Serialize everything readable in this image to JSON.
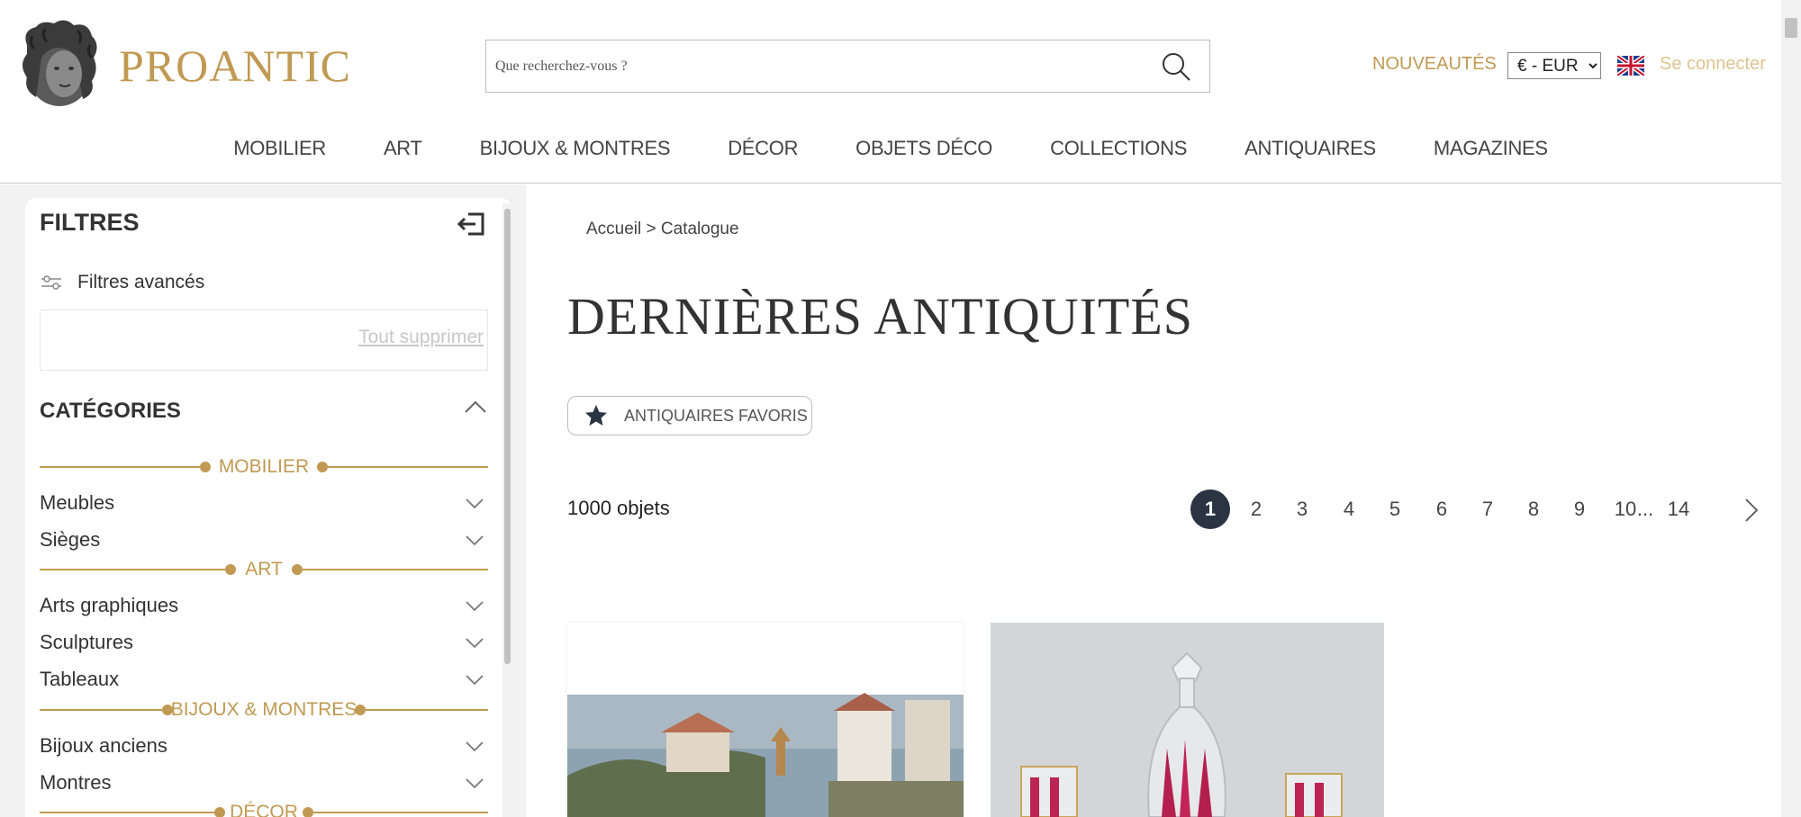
{
  "header": {
    "logo_text": "PROANTIC",
    "search_placeholder": "Que recherchez-vous ?",
    "new_label": "NOUVEAUTÉS",
    "currency": "€ - EUR",
    "login_label": "Se connecter",
    "flag_icon": "uk-flag-icon",
    "search_icon": "search-icon"
  },
  "nav": [
    "MOBILIER",
    "ART",
    "BIJOUX & MONTRES",
    "DÉCOR",
    "OBJETS DÉCO",
    "COLLECTIONS",
    "ANTIQUAIRES",
    "MAGAZINES"
  ],
  "sidebar": {
    "title": "FILTRES",
    "advanced_filters": "Filtres avancés",
    "clear_all": "Tout supprimer",
    "categories_title": "CATÉGORIES",
    "groups": [
      {
        "label": "MOBILIER",
        "items": [
          "Meubles",
          "Sièges"
        ]
      },
      {
        "label": "ART",
        "items": [
          "Arts graphiques",
          "Sculptures",
          "Tableaux"
        ]
      },
      {
        "label": "BIJOUX & MONTRES",
        "items": [
          "Bijoux anciens",
          "Montres"
        ]
      },
      {
        "label": "DÉCOR",
        "items": []
      }
    ]
  },
  "main": {
    "breadcrumb": "Accueil > Catalogue",
    "title": "DERNIÈRES ANTIQUITÉS",
    "fav_label": "ANTIQUAIRES FAVORIS",
    "count": "1000 objets",
    "pagination": [
      "1",
      "2",
      "3",
      "4",
      "5",
      "6",
      "7",
      "8",
      "9",
      "10",
      "...",
      "14"
    ],
    "current_page": "1"
  },
  "colors": {
    "brand_gold": "#c09a52",
    "active_page": "#2a3442"
  }
}
